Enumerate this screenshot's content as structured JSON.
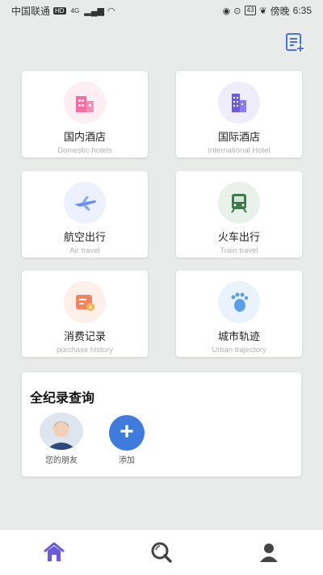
{
  "status_bar": {
    "carrier": "中国联通",
    "hd": "HD",
    "net": "4G",
    "battery": "43",
    "extra": "傍晚",
    "time": "6:35"
  },
  "top_action": {
    "icon": "note-add-icon"
  },
  "services": [
    {
      "title": "国内酒店",
      "subtitle": "Domestic hotels",
      "icon": "hotel-building-icon",
      "color": "#f0609a",
      "bg": "#fdeef3"
    },
    {
      "title": "国际酒店",
      "subtitle": "International Hotel",
      "icon": "international-building-icon",
      "color": "#6b5bd6",
      "bg": "#efecfb"
    },
    {
      "title": "航空出行",
      "subtitle": "Air travel",
      "icon": "airplane-icon",
      "color": "#6a8ff0",
      "bg": "#ecf1fd"
    },
    {
      "title": "火车出行",
      "subtitle": "Train travel",
      "icon": "train-icon",
      "color": "#3b7a4c",
      "bg": "#e9f2ea"
    },
    {
      "title": "消费记录",
      "subtitle": "purchase history",
      "icon": "receipt-icon",
      "color": "#f2845c",
      "bg": "#fdefe9"
    },
    {
      "title": "城市轨迹",
      "subtitle": "Urban trajectory",
      "icon": "footprint-icon",
      "color": "#5aa0e8",
      "bg": "#eaf3fc"
    }
  ],
  "record_panel": {
    "title": "全纪录查询",
    "friend_label": "您的朋友",
    "add_symbol": "+",
    "add_label": "添加"
  },
  "bottom_nav": [
    {
      "icon": "home-icon",
      "color": "#6b5bd6"
    },
    {
      "icon": "search-icon",
      "color": "#444444"
    },
    {
      "icon": "user-icon",
      "color": "#444444"
    }
  ]
}
